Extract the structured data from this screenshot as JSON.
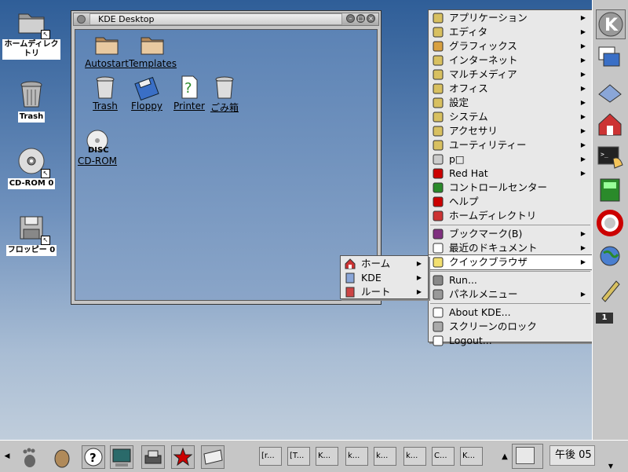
{
  "desktop": {
    "icons": [
      {
        "label": "ホームディレクトリ",
        "icon": "folder-icon"
      },
      {
        "label": "Trash",
        "icon": "trash-icon"
      },
      {
        "label": "CD-ROM 0",
        "icon": "cdrom-icon"
      },
      {
        "label": "フロッピー 0",
        "icon": "floppy-icon"
      }
    ]
  },
  "window": {
    "title": "KDE Desktop",
    "icons": [
      {
        "label": "Autostart",
        "icon": "folder-icon"
      },
      {
        "label": "Templates",
        "icon": "folder-icon"
      },
      {
        "label": "Trash",
        "icon": "trash-icon"
      },
      {
        "label": "Floppy",
        "icon": "floppy-icon"
      },
      {
        "label": "Printer",
        "icon": "printer-icon"
      },
      {
        "label": "ごみ箱",
        "icon": "trash-icon"
      },
      {
        "label": "CD-ROM",
        "icon": "cdrom-icon"
      }
    ]
  },
  "k_menu": {
    "items": [
      {
        "label": "アプリケーション",
        "submenu": true
      },
      {
        "label": "エディタ",
        "submenu": true
      },
      {
        "label": "グラフィックス",
        "submenu": true
      },
      {
        "label": "インターネット",
        "submenu": true
      },
      {
        "label": "マルチメディア",
        "submenu": true
      },
      {
        "label": "オフィス",
        "submenu": true
      },
      {
        "label": "設定",
        "submenu": true
      },
      {
        "label": "システム",
        "submenu": true
      },
      {
        "label": "アクセサリ",
        "submenu": true
      },
      {
        "label": "ユーティリティー",
        "submenu": true
      },
      {
        "label": "p□",
        "submenu": true
      },
      {
        "label": "Red Hat",
        "submenu": true
      },
      {
        "label": "コントロールセンター",
        "submenu": false
      },
      {
        "label": "ヘルプ",
        "submenu": false
      },
      {
        "label": "ホームディレクトリ",
        "submenu": false
      },
      {
        "label": "ブックマーク(B)",
        "submenu": true
      },
      {
        "label": "最近のドキュメント",
        "submenu": true
      },
      {
        "label": "クイックブラウザ",
        "submenu": true
      },
      {
        "label": "Run...",
        "submenu": false
      },
      {
        "label": "パネルメニュー",
        "submenu": true
      },
      {
        "label": "About KDE...",
        "submenu": false
      },
      {
        "label": "スクリーンのロック",
        "submenu": false
      },
      {
        "label": "Logout...",
        "submenu": false
      }
    ]
  },
  "quick_browser": {
    "items": [
      {
        "label": "ホーム"
      },
      {
        "label": "KDE"
      },
      {
        "label": "ルート"
      }
    ]
  },
  "taskbar": {
    "tasks": [
      "[r...",
      "[T...",
      "K...",
      "k...",
      "k...",
      "k...",
      "C...",
      "K..."
    ],
    "clock": "午後 05",
    "pager_label": "1"
  },
  "colors": {
    "desktop_top": "#2f5e98",
    "menu_bg": "#e8e8e8",
    "panel_bg": "#c6c6c6"
  }
}
